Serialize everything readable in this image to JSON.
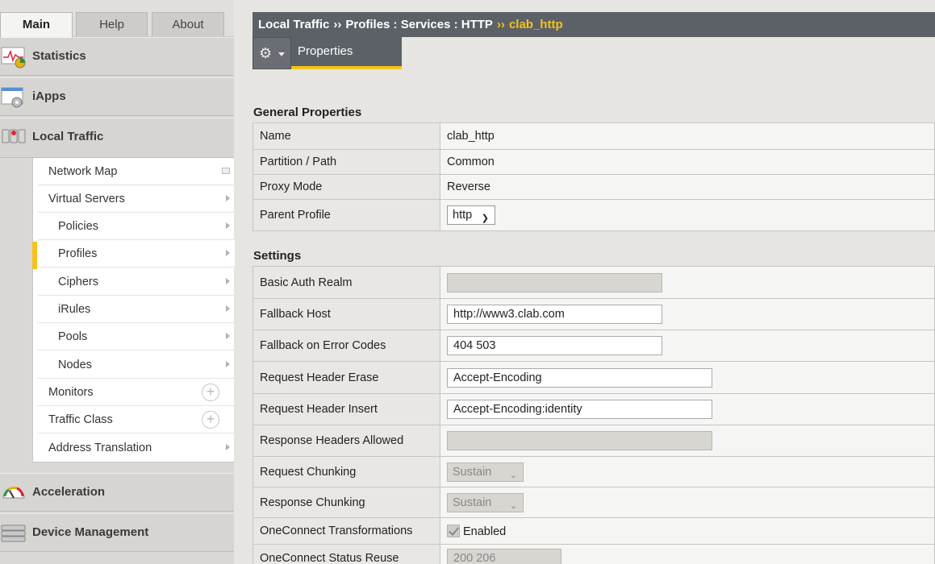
{
  "main_tabs": [
    {
      "label": "Main"
    },
    {
      "label": "Help"
    },
    {
      "label": "About"
    }
  ],
  "nav_sections": {
    "statistics": "Statistics",
    "iapps": "iApps",
    "local_traffic": "Local Traffic",
    "acceleration": "Acceleration",
    "device_management": "Device Management"
  },
  "subnav": [
    {
      "label": "Network Map"
    },
    {
      "label": "Virtual Servers"
    },
    {
      "label": "Policies"
    },
    {
      "label": "Profiles"
    },
    {
      "label": "Ciphers"
    },
    {
      "label": "iRules"
    },
    {
      "label": "Pools"
    },
    {
      "label": "Nodes"
    },
    {
      "label": "Monitors"
    },
    {
      "label": "Traffic Class"
    },
    {
      "label": "Address Translation"
    }
  ],
  "breadcrumb": {
    "part1": "Local Traffic",
    "sep1": "››",
    "part2": "Profiles : Services : HTTP",
    "sep2": "››",
    "current": "clab_http"
  },
  "toolbar": {
    "properties_tab": "Properties"
  },
  "general": {
    "heading": "General Properties",
    "name_label": "Name",
    "name_value": "clab_http",
    "partition_label": "Partition / Path",
    "partition_value": "Common",
    "proxy_label": "Proxy Mode",
    "proxy_value": "Reverse",
    "parent_label": "Parent Profile",
    "parent_value": "http"
  },
  "settings": {
    "heading": "Settings",
    "basic_auth_label": "Basic Auth Realm",
    "basic_auth_value": "",
    "fallback_host_label": "Fallback Host",
    "fallback_host_value": "http://www3.clab.com",
    "fallback_codes_label": "Fallback on Error Codes",
    "fallback_codes_value": "404 503",
    "req_erase_label": "Request Header Erase",
    "req_erase_value": "Accept-Encoding",
    "req_insert_label": "Request Header Insert",
    "req_insert_value": "Accept-Encoding:identity",
    "resp_allowed_label": "Response Headers Allowed",
    "resp_allowed_value": "",
    "req_chunk_label": "Request Chunking",
    "req_chunk_value": "Sustain",
    "resp_chunk_label": "Response Chunking",
    "resp_chunk_value": "Sustain",
    "oneconnect_label": "OneConnect Transformations",
    "oneconnect_value": "Enabled",
    "oneconnect_status_label": "OneConnect Status Reuse",
    "oneconnect_status_value": "200 206"
  },
  "colors": {
    "accent": "#f5c21a",
    "header_bg": "#5c6168"
  }
}
